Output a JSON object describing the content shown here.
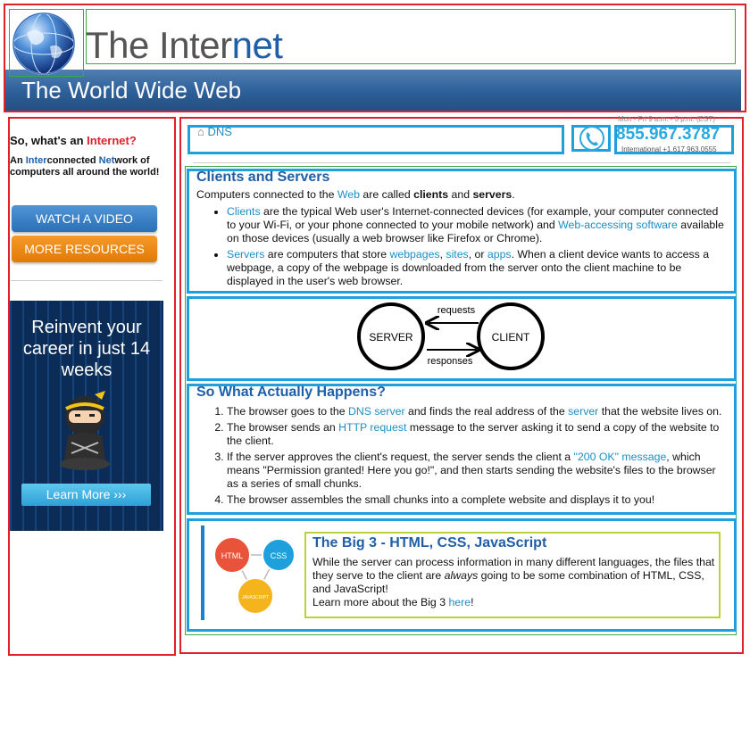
{
  "header": {
    "title_part1": "The Inter",
    "title_part2": "net",
    "banner": "The World Wide Web"
  },
  "sidebar": {
    "question_prefix": "So, what's an ",
    "question_highlight": "Internet?",
    "desc_p1": "An ",
    "desc_h1": "Inter",
    "desc_p2": "connected ",
    "desc_h2": "Net",
    "desc_p3": "work of computers all around the world!",
    "watch_button": "WATCH A VIDEO",
    "resources_button": "MORE RESOURCES",
    "ad_text": "Reinvent your career in just 14 weeks",
    "ad_button": "Learn More ›››"
  },
  "topbar": {
    "breadcrumb": "DNS",
    "hours": "Mon - Fri 9 a.m. - 5 p.m. (EST)",
    "phone": "855.967.3787",
    "international": "International +1.617.963.0555"
  },
  "section1": {
    "title": "Clients and Servers",
    "intro_p1": "Computers connected to the ",
    "intro_link": "Web",
    "intro_p2": " are called ",
    "intro_b1": "clients",
    "intro_p3": " and ",
    "intro_b2": "servers",
    "intro_p4": ".",
    "clients_link": "Clients",
    "clients_text1": " are the typical Web user's Internet-connected devices (for example, your computer connected to your Wi-Fi, or your phone connected to your mobile network) and ",
    "clients_link2": "Web-accessing software",
    "clients_text2": " available on those devices (usually a web browser like Firefox or Chrome).",
    "servers_link": "Servers",
    "servers_text1": " are computers that store ",
    "webpages_link": "webpages",
    "sep1": ", ",
    "sites_link": "sites",
    "sep2": ", or ",
    "apps_link": "apps",
    "servers_text2": ". When a client device wants to access a webpage, a copy of the webpage is downloaded from the server onto the client machine to be displayed in the user's web browser."
  },
  "diagram": {
    "server": "SERVER",
    "client": "CLIENT",
    "requests": "requests",
    "responses": "responses"
  },
  "section3": {
    "title": "So What Actually Happens?",
    "s1_a": "The browser goes to the ",
    "s1_link1": "DNS server",
    "s1_b": " and finds the real address of the ",
    "s1_link2": "server",
    "s1_c": " that the website lives on.",
    "s2_a": "The browser sends an ",
    "s2_link": "HTTP request",
    "s2_b": " message to the server asking it to send a copy of the website to the client.",
    "s3_a": "If the server approves the client's request, the server sends the client a ",
    "s3_link": "\"200 OK\" message",
    "s3_b": ", which means \"Permission granted! Here you go!\", and then starts sending the website's files to the browser as a series of small chunks.",
    "s4": "The browser assembles the small chunks into a complete website and displays it to you!"
  },
  "big3": {
    "title": "The Big 3 - HTML, CSS, JavaScript",
    "body_p1": "While the server can process information in many different languages, the files that they serve to the client are ",
    "body_em": "always",
    "body_p2": " going to be some combination of HTML, CSS, and JavaScript!",
    "more_p1": "Learn more about the Big 3 ",
    "more_link": "here",
    "more_p2": "!",
    "logo_html": "HTML",
    "logo_css": "CSS",
    "logo_js": "JAVASCRIPT"
  }
}
